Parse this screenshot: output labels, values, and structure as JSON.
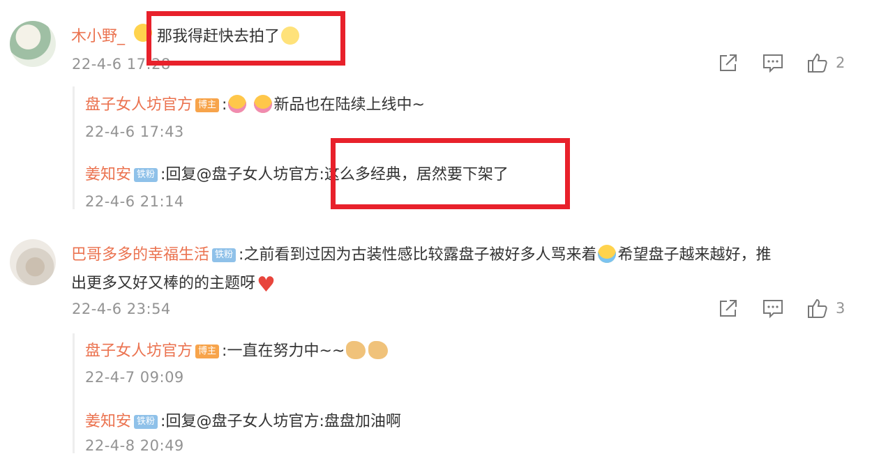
{
  "comments": [
    {
      "user": "木小野_",
      "text": "那我得赶快去拍了",
      "time": "22-4-6 17:28",
      "likes": "2",
      "replies": [
        {
          "user": "盘子女人坊官方",
          "badge": "博主",
          "text": "新品也在陆续上线中~",
          "time": "22-4-6 17:43"
        },
        {
          "user": "姜知安",
          "badge": "铁粉",
          "text": ":回复@盘子女人坊官方:这么多经典，居然要下架了",
          "time": "22-4-6 21:14"
        }
      ]
    },
    {
      "user": "巴哥多多的幸福生活",
      "badge": "铁粉",
      "text_line1": "之前看到过因为古装性感比较露盘子被好多人骂来着",
      "text_line1b": "希望盘子越来越好，推",
      "text_line2": "出更多又好又棒的的主题呀",
      "time": "22-4-6 23:54",
      "likes": "3",
      "replies": [
        {
          "user": "盘子女人坊官方",
          "badge": "博主",
          "text": ":一直在努力中~~",
          "time": "22-4-7 09:09"
        },
        {
          "user": "姜知安",
          "badge": "铁粉",
          "text": ":回复@盘子女人坊官方:盘盘加油啊",
          "time": "22-4-8 20:49"
        }
      ]
    }
  ],
  "icons": [
    "share-icon",
    "comment-icon",
    "like-icon",
    "emoji-icon"
  ],
  "colors": {
    "username": "#eb7350",
    "highlight_box": "#e8212b",
    "badge_blogger": "#f7a44b",
    "badge_fan": "#8fc1e9"
  }
}
